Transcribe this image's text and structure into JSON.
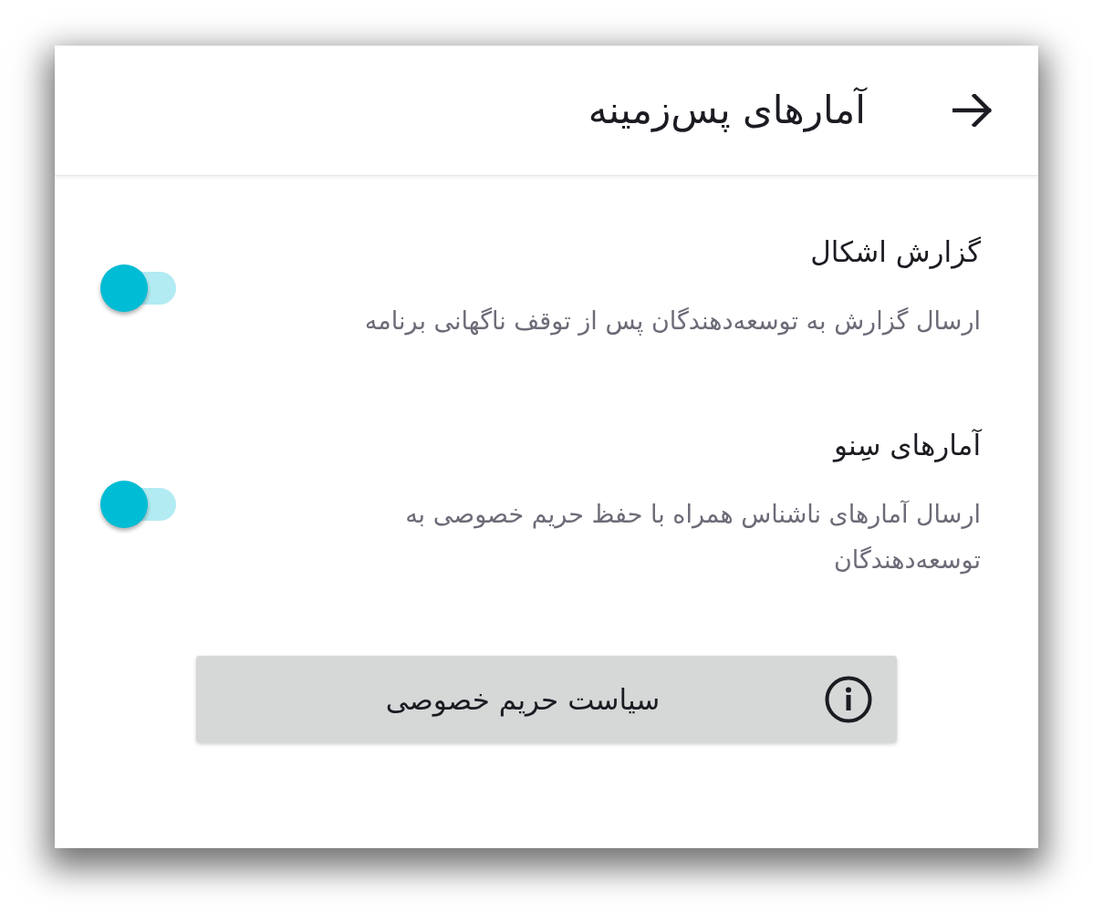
{
  "header": {
    "title": "آمارهای پس‌زمینه"
  },
  "settings": [
    {
      "title": "گزارش اشکال",
      "description": "ارسال گزارش به توسعه‌دهندگان پس از توقف ناگهانی برنامه",
      "on": true
    },
    {
      "title": "آمارهای سِنو",
      "description": "ارسال آمارهای ناشناس همراه با حفظ حریم خصوصی به توسعه‌دهندگان",
      "on": true
    }
  ],
  "privacy_button": {
    "label": "سیاست حریم خصوصی"
  }
}
